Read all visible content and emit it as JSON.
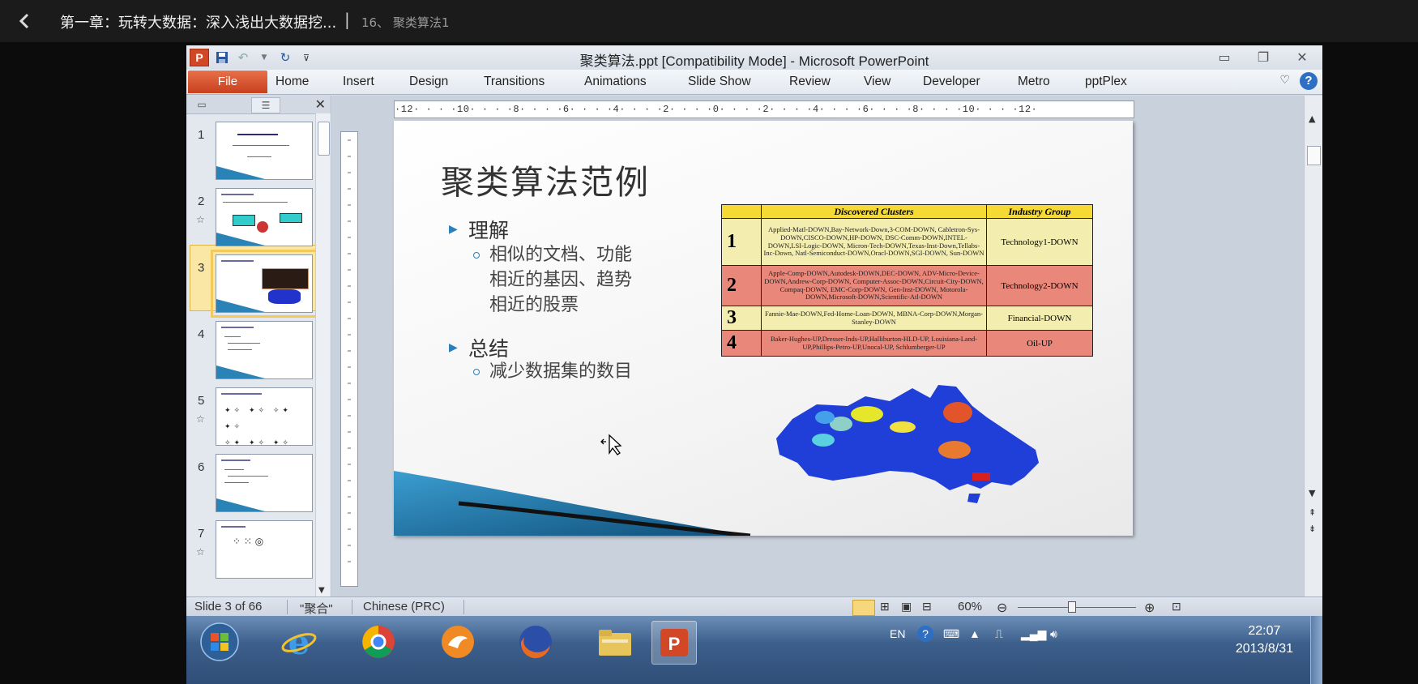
{
  "player": {
    "back_icon": "chevron-left-icon",
    "course_title": "第一章：玩转大数据：深入浅出大数据挖...",
    "separator": "|",
    "lesson": "16、 聚类算法1"
  },
  "window": {
    "title": "聚类算法.ppt [Compatibility Mode] - Microsoft PowerPoint"
  },
  "ribbon": {
    "file": "File",
    "tabs": [
      "Home",
      "Insert",
      "Design",
      "Transitions",
      "Animations",
      "Slide Show",
      "Review",
      "View",
      "Developer",
      "Metro",
      "pptPlex"
    ],
    "help": "?"
  },
  "ruler": {
    "text": "·12· · · ·10· · · ·8· · · ·6· · · ·4· · · ·2· · · ·0· · · ·2· · · ·4· · · ·6· · · ·8· · · ·10· · · ·12·"
  },
  "slides_panel": {
    "slides": [
      {
        "num": "1",
        "star": ""
      },
      {
        "num": "2",
        "star": "☆"
      },
      {
        "num": "3",
        "star": ""
      },
      {
        "num": "4",
        "star": ""
      },
      {
        "num": "5",
        "star": "☆"
      },
      {
        "num": "6",
        "star": ""
      },
      {
        "num": "7",
        "star": "☆"
      }
    ],
    "selected": 3
  },
  "slide": {
    "title": "聚类算法范例",
    "bullet1": "理解",
    "sub1_line1": "相似的文档、功能",
    "sub1_line2": "相近的基因、趋势",
    "sub1_line3": "相近的股票",
    "bullet2": "总结",
    "sub2": "减少数据集的数目",
    "table": {
      "headers": [
        "Discovered Clusters",
        "Industry Group"
      ],
      "rows": [
        {
          "num": "1",
          "color": "#f3eeb0",
          "clusters": "Applied-Matl-DOWN,Bay-Network-Down,3-COM-DOWN, Cabletron-Sys-DOWN,CISCO-DOWN,HP-DOWN, DSC-Comm-DOWN,INTEL-DOWN,LSI-Logic-DOWN, Micron-Tech-DOWN,Texas-Inst-Down,Tellabs-Inc-Down, Natl-Semiconduct-DOWN,Oracl-DOWN,SGI-DOWN, Sun-DOWN",
          "group": "Technology1-DOWN"
        },
        {
          "num": "2",
          "color": "#e9877a",
          "clusters": "Apple-Comp-DOWN,Autodesk-DOWN,DEC-DOWN, ADV-Micro-Device-DOWN,Andrew-Corp-DOWN, Computer-Assoc-DOWN,Circuit-City-DOWN, Compaq-DOWN, EMC-Corp-DOWN, Gen-Inst-DOWN, Motorola-DOWN,Microsoft-DOWN,Scientific-Atl-DOWN",
          "group": "Technology2-DOWN"
        },
        {
          "num": "3",
          "color": "#f3eeb0",
          "clusters": "Fannie-Mae-DOWN,Fed-Home-Loan-DOWN, MBNA-Corp-DOWN,Morgan-Stanley-DOWN",
          "group": "Financial-DOWN"
        },
        {
          "num": "4",
          "color": "#e9877a",
          "clusters": "Baker-Hughes-UP,Dresser-Inds-UP,Halliburton-HLD-UP, Louisiana-Land-UP,Phillips-Petro-UP,Unocal-UP, Schlumberger-UP",
          "group": "Oil-UP"
        }
      ]
    }
  },
  "status": {
    "slide_info": "Slide 3 of 66",
    "theme": "\"聚合\"",
    "language": "Chinese (PRC)",
    "zoom": "60%",
    "zoom_fraction": 0.45
  },
  "taskbar": {
    "apps": [
      "windows-start-icon",
      "internet-explorer-icon",
      "chrome-icon",
      "app-icon",
      "firefox-icon",
      "explorer-icon",
      "powerpoint-icon"
    ],
    "lang": "EN",
    "time": "22:07",
    "date": "2013/8/31"
  }
}
